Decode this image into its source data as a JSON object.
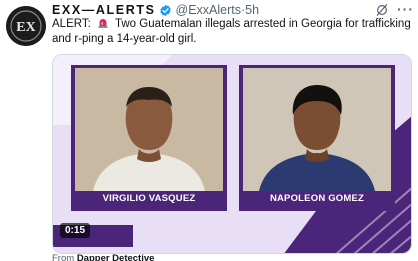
{
  "tweet": {
    "display_name": "EXX—ALERTS",
    "handle": "@ExxAlerts",
    "separator": " · ",
    "time": "5h",
    "text_prefix": "ALERT:",
    "text_body": " Two Guatemalan illegals arrested in Georgia for trafficking and r-ping a 14-year-old girl.",
    "avatar_text": "EX",
    "more_label": "···"
  },
  "media": {
    "left_caption": "VIRGILIO VASQUEZ",
    "right_caption": "NAPOLEON GOMEZ",
    "duration": "0:15",
    "from_prefix": "From ",
    "from_name": "Dapper Detective"
  },
  "icons": {
    "verified": "verified-badge-icon",
    "siren": "siren-emoji-icon",
    "grok": "grok-icon",
    "more": "more-options-icon"
  },
  "colors": {
    "purple": "#4a2579",
    "light_purple": "#d9c9ef",
    "verified_blue": "#1d9bf0",
    "muted": "#536471"
  }
}
